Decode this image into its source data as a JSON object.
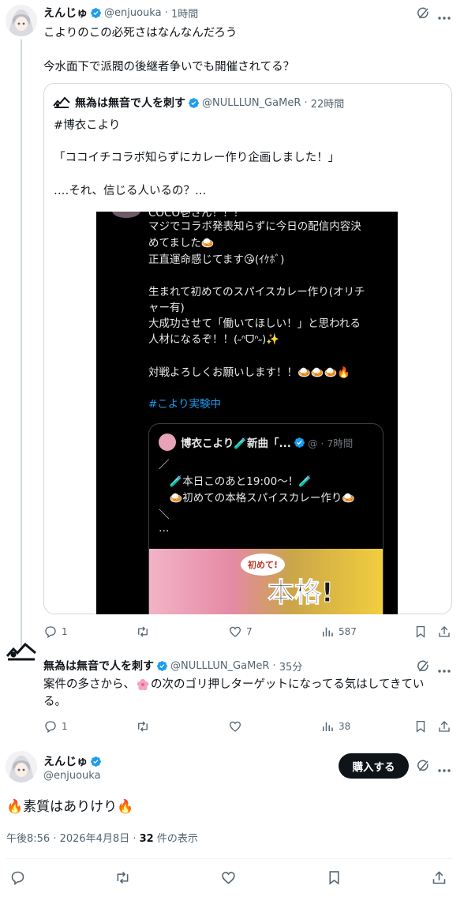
{
  "tweet1": {
    "display_name": "えんじゅ",
    "handle": "@enjuouka",
    "time": "1時間",
    "text_line1": "こよりのこの必死さはなんなんだろう",
    "text_line2": "今水面下で派閥の後継者争いでも開催されてる？"
  },
  "quote": {
    "display_name": "無為は無音で人を刺す",
    "handle": "@NULLLUN_GaMeR",
    "time": "22時間",
    "hashtag": "#博衣こより",
    "line1": "「ココイチコラボ知らずにカレー作り企画しました！」",
    "line2": "‥‥それ、信じる人いるの？…"
  },
  "screenshot": {
    "lines": [
      "COCO壱さん！！！",
      "マジでコラボ発表知らずに今日の配信内容決",
      "めてました🍛",
      "正直運命感じてます😘(ｲｹﾎﾞ)",
      "",
      "生まれて初めてのスパイスカレー作り(オリチ",
      "ャー有)",
      "大成功させて「働いてほしい！」と思われる",
      "人材になるぞ！！(˶ᐢᗜᐢ˶)✨",
      "",
      "対戦よろしくお願いします！！🍛🍛🍛🔥"
    ],
    "hashtag": "#こより実験中",
    "inner": {
      "name": "博衣こより🧪新曲「...",
      "time": "@ · 7時間",
      "lines": [
        "／",
        "　🧪本日このあと19:00～！🧪",
        "　🍛初めての本格スパイスカレー作り🍛",
        "＼",
        "…"
      ],
      "banner_small": "初めて!",
      "banner_big": "本格!"
    }
  },
  "tweet1_actions": {
    "replies": "1",
    "retweets": "",
    "likes": "7",
    "views": "587"
  },
  "tweet2": {
    "display_name": "無為は無音で人を刺す",
    "handle": "@NULLLUN_GaMeR",
    "time": "35分",
    "text_before": "案件の多さから、",
    "text_after": "の次のゴリ押しターゲットになってる気はしてきてい",
    "text_line2": "る。"
  },
  "tweet2_actions": {
    "replies": "1",
    "retweets": "",
    "likes": "",
    "views": "38"
  },
  "main": {
    "display_name": "えんじゅ",
    "handle": "@enjuouka",
    "buy_label": "購入する",
    "text": "🔥素質はありけり🔥",
    "timestamp": "午後8:56 · 2026年4月8日 · ",
    "view_count": "32",
    "view_suffix": " 件の表示"
  },
  "colors": {
    "verified": "#1d9bf0",
    "text": "#0f1419",
    "muted": "#536471",
    "hashtag": "#1d9bf0",
    "border": "#cfd9de"
  }
}
